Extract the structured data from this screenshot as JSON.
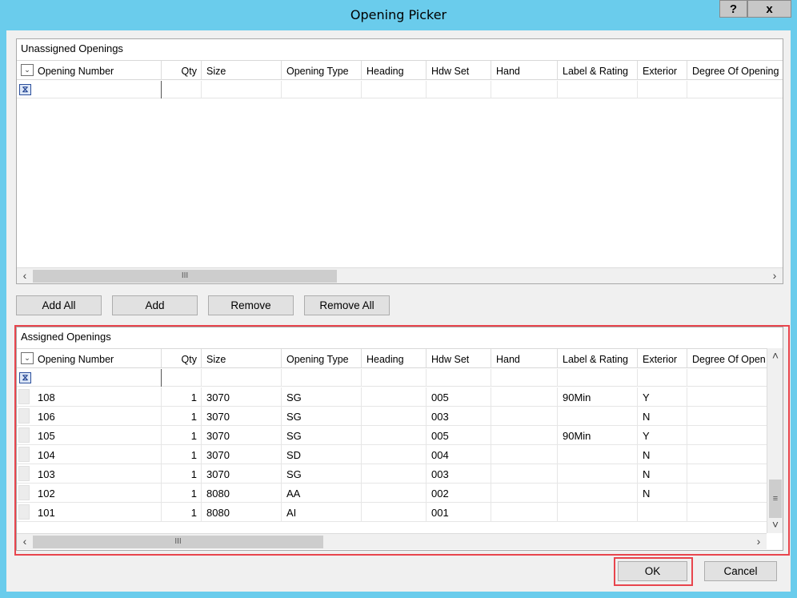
{
  "window": {
    "title": "Opening Picker",
    "help_glyph": "?",
    "close_glyph": "x"
  },
  "columns": [
    "Opening Number",
    "Qty",
    "Size",
    "Opening Type",
    "Heading",
    "Hdw Set",
    "Hand",
    "Label & Rating",
    "Exterior",
    "Degree Of Opening"
  ],
  "assigned_last_header": "Degree Of Open",
  "unassigned": {
    "title": "Unassigned Openings",
    "rows": []
  },
  "buttons": {
    "add_all": "Add All",
    "add": "Add",
    "remove": "Remove",
    "remove_all": "Remove All",
    "ok": "OK",
    "cancel": "Cancel"
  },
  "assigned": {
    "title": "Assigned Openings",
    "rows": [
      {
        "opening_number": "108",
        "qty": "1",
        "size": "3070",
        "opening_type": "SG",
        "heading": "",
        "hdw_set": "005",
        "hand": "",
        "label_rating": "90Min",
        "exterior": "Y",
        "degree": ""
      },
      {
        "opening_number": "106",
        "qty": "1",
        "size": "3070",
        "opening_type": "SG",
        "heading": "",
        "hdw_set": "003",
        "hand": "",
        "label_rating": "",
        "exterior": "N",
        "degree": ""
      },
      {
        "opening_number": "105",
        "qty": "1",
        "size": "3070",
        "opening_type": "SG",
        "heading": "",
        "hdw_set": "005",
        "hand": "",
        "label_rating": "90Min",
        "exterior": "Y",
        "degree": ""
      },
      {
        "opening_number": "104",
        "qty": "1",
        "size": "3070",
        "opening_type": "SD",
        "heading": "",
        "hdw_set": "004",
        "hand": "",
        "label_rating": "",
        "exterior": "N",
        "degree": ""
      },
      {
        "opening_number": "103",
        "qty": "1",
        "size": "3070",
        "opening_type": "SG",
        "heading": "",
        "hdw_set": "003",
        "hand": "",
        "label_rating": "",
        "exterior": "N",
        "degree": ""
      },
      {
        "opening_number": "102",
        "qty": "1",
        "size": "8080",
        "opening_type": "AA",
        "heading": "",
        "hdw_set": "002",
        "hand": "",
        "label_rating": "",
        "exterior": "N",
        "degree": ""
      },
      {
        "opening_number": "101",
        "qty": "1",
        "size": "8080",
        "opening_type": "AI",
        "heading": "",
        "hdw_set": "001",
        "hand": "",
        "label_rating": "",
        "exterior": "",
        "degree": ""
      }
    ]
  },
  "icons": {
    "column_chooser": "chevron-down-icon",
    "filter": "filter-icon",
    "scroll_left": "‹",
    "scroll_right": "›",
    "scroll_up": "˄",
    "scroll_down": "˅",
    "grip": "III",
    "vgrip": "≡"
  },
  "colors": {
    "titlebar": "#6accec",
    "highlight": "#e8454d"
  }
}
